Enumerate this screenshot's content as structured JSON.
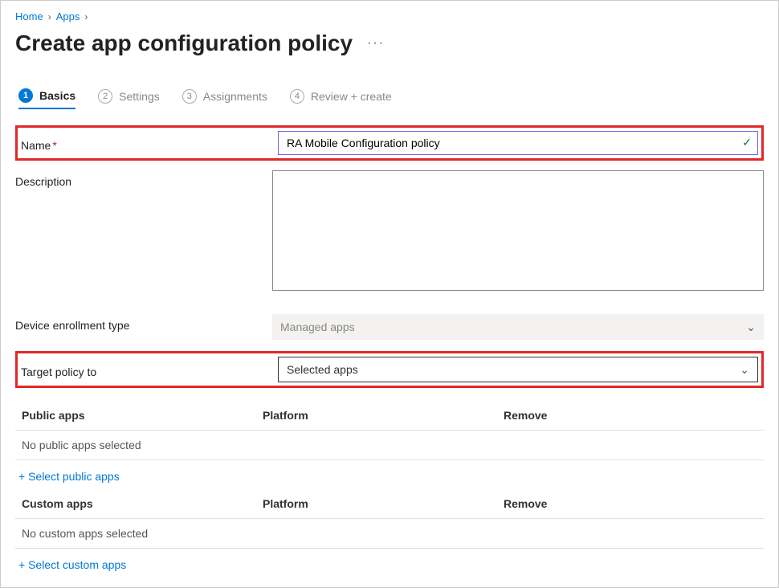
{
  "breadcrumb": {
    "home": "Home",
    "apps": "Apps"
  },
  "page": {
    "title": "Create app configuration policy"
  },
  "tabs": {
    "basics": {
      "num": "1",
      "label": "Basics"
    },
    "settings": {
      "num": "2",
      "label": "Settings"
    },
    "assignments": {
      "num": "3",
      "label": "Assignments"
    },
    "review": {
      "num": "4",
      "label": "Review + create"
    }
  },
  "form": {
    "name_label": "Name",
    "name_value": "RA Mobile Configuration policy",
    "desc_label": "Description",
    "desc_value": "",
    "enrollment_label": "Device enrollment type",
    "enrollment_value": "Managed apps",
    "target_label": "Target policy to",
    "target_value": "Selected apps"
  },
  "tables": {
    "public": {
      "header": "Public apps",
      "platform": "Platform",
      "remove": "Remove",
      "empty": "No public apps selected",
      "select_link": "+ Select public apps"
    },
    "custom": {
      "header": "Custom apps",
      "platform": "Platform",
      "remove": "Remove",
      "empty": "No custom apps selected",
      "select_link": "+ Select custom apps"
    }
  }
}
